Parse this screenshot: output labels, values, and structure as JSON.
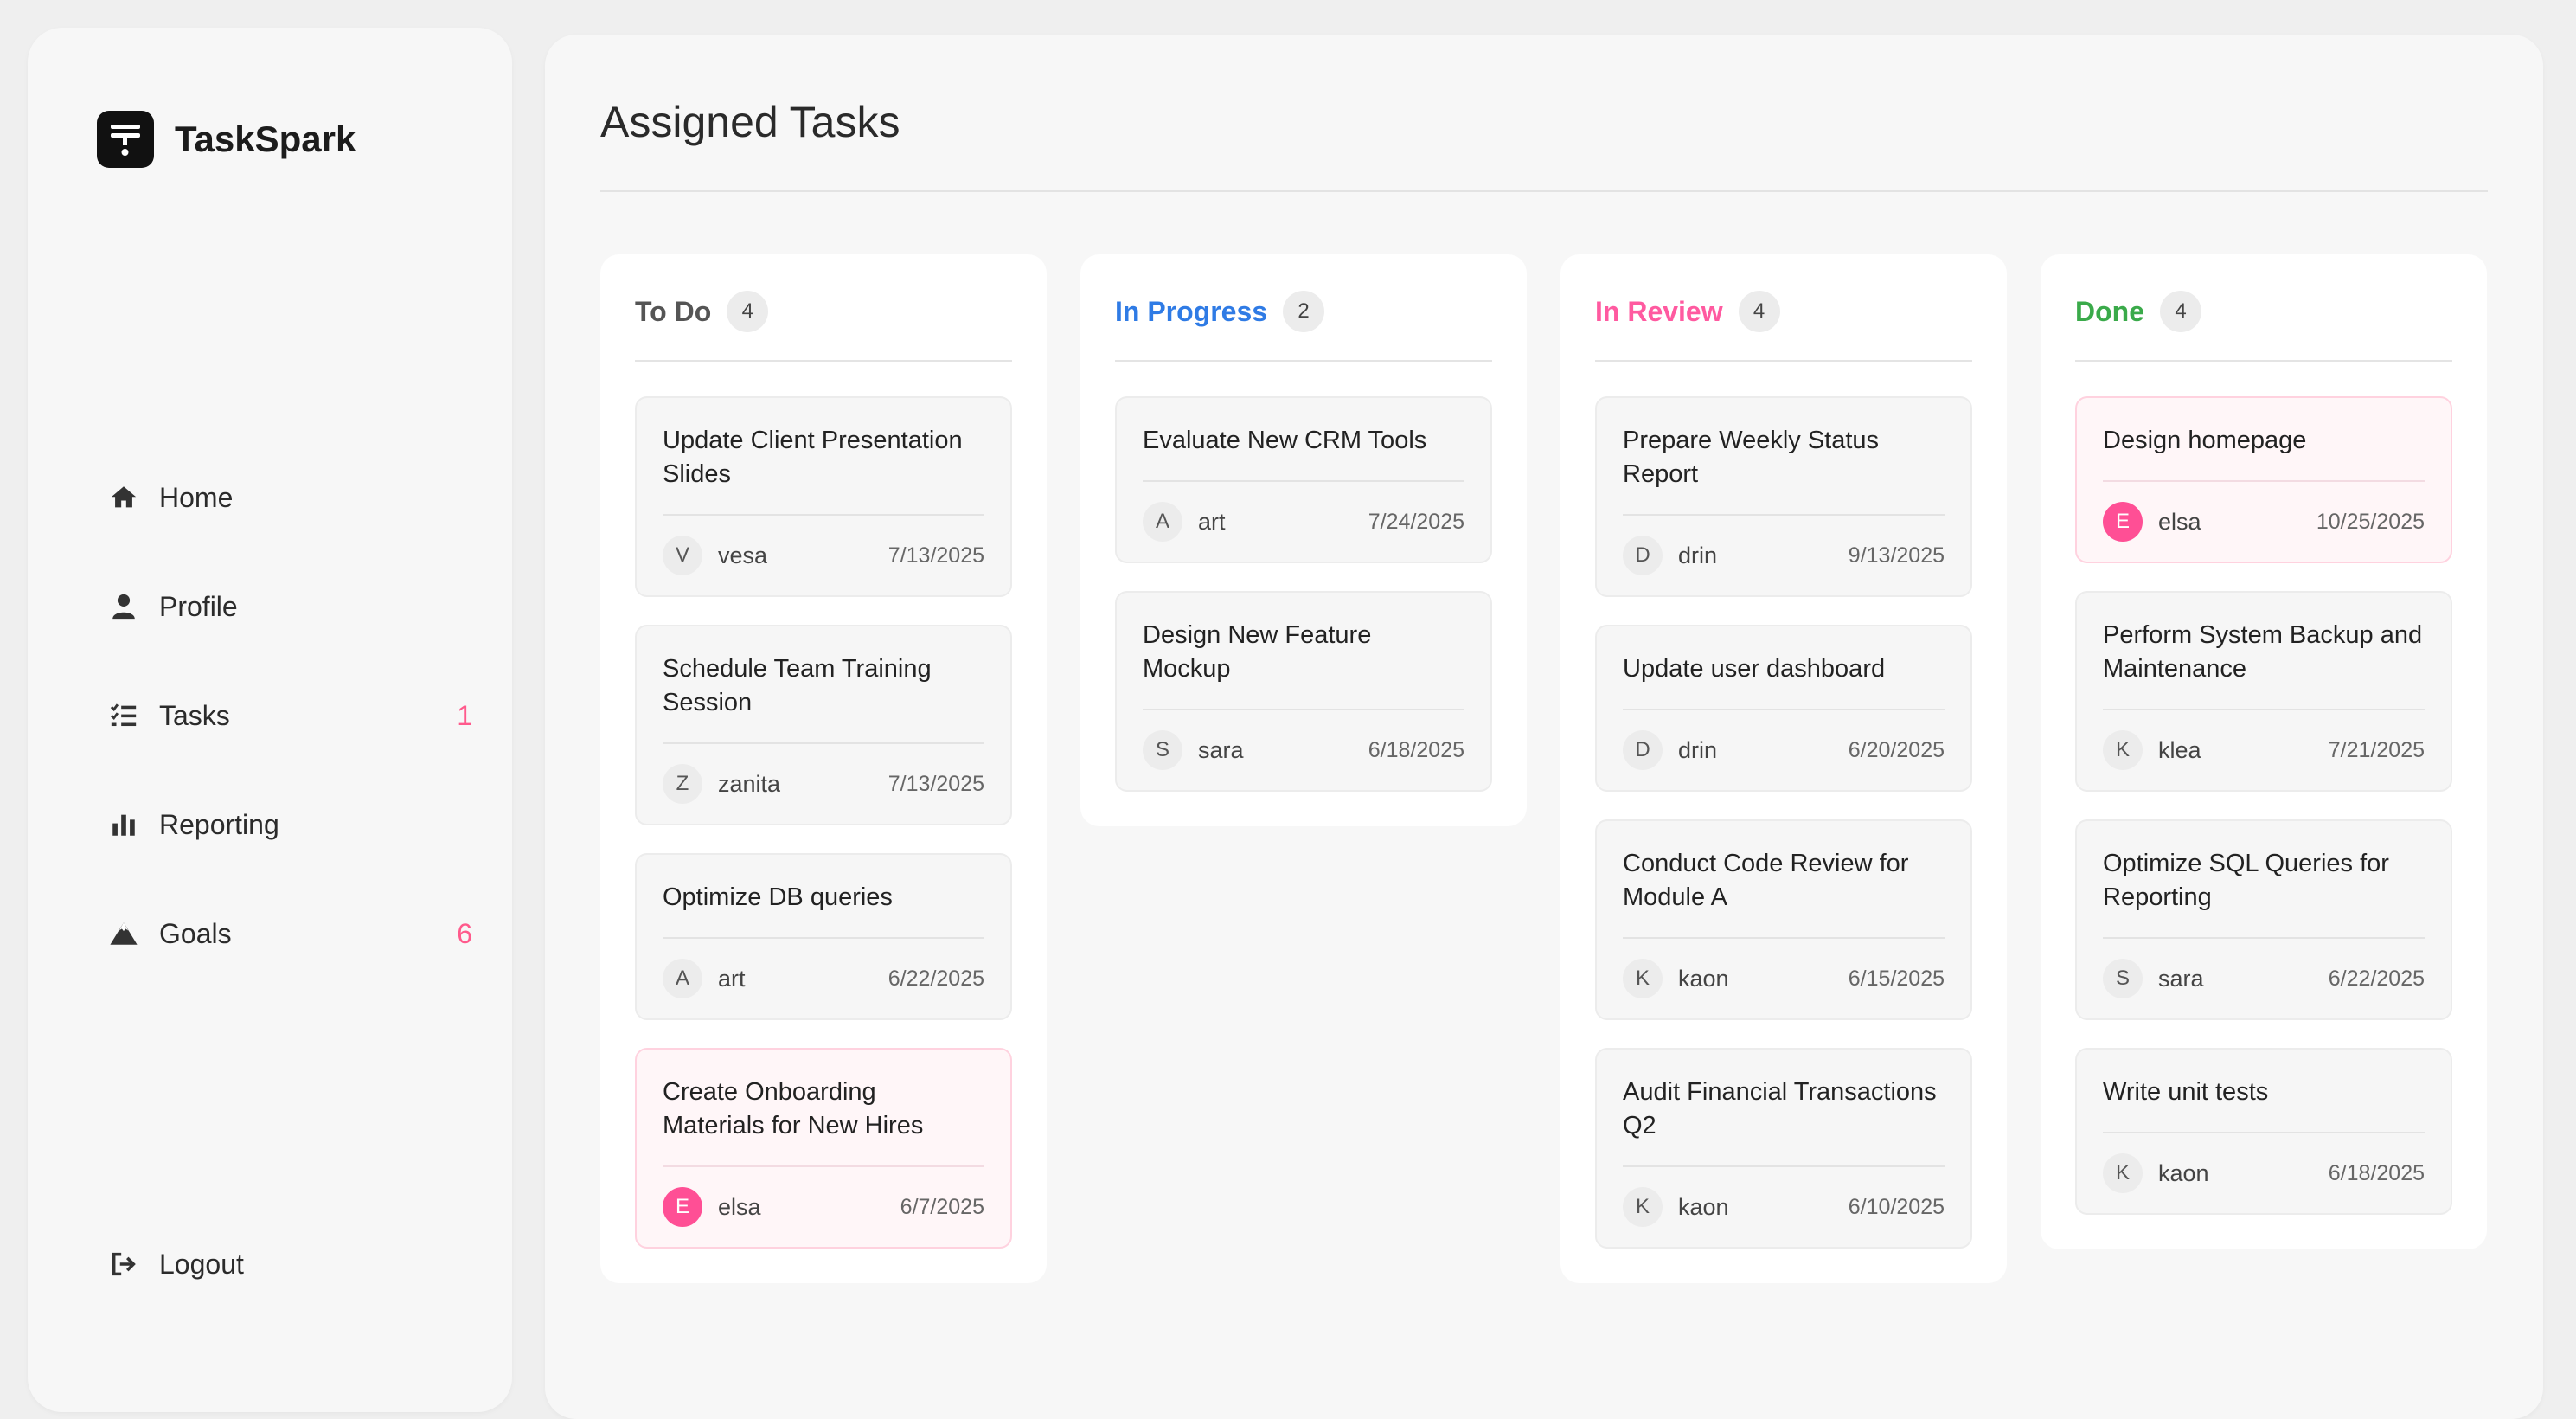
{
  "brand": {
    "name": "TaskSpark"
  },
  "nav": {
    "items": [
      {
        "label": "Home",
        "icon": "home-icon",
        "badge": ""
      },
      {
        "label": "Profile",
        "icon": "user-icon",
        "badge": ""
      },
      {
        "label": "Tasks",
        "icon": "checklist-icon",
        "badge": "1"
      },
      {
        "label": "Reporting",
        "icon": "bar-chart-icon",
        "badge": ""
      },
      {
        "label": "Goals",
        "icon": "mountain-icon",
        "badge": "6"
      }
    ],
    "logout": {
      "label": "Logout",
      "icon": "logout-icon"
    }
  },
  "page": {
    "title": "Assigned Tasks"
  },
  "colors": {
    "todo": "#555555",
    "in_progress": "#2f7be5",
    "in_review": "#ff5aa0",
    "done": "#3aaa4a",
    "badge": "#ff5a8c"
  },
  "columns": [
    {
      "title": "To Do",
      "count": "4",
      "cards": [
        {
          "title": "Update Client Presentation Slides",
          "initial": "V",
          "assignee": "vesa",
          "date": "7/13/2025"
        },
        {
          "title": "Schedule Team Training Session",
          "initial": "Z",
          "assignee": "zanita",
          "date": "7/13/2025"
        },
        {
          "title": "Optimize DB queries",
          "initial": "A",
          "assignee": "art",
          "date": "6/22/2025"
        },
        {
          "title": "Create Onboarding Materials for New Hires",
          "initial": "E",
          "assignee": "elsa",
          "date": "6/7/2025"
        }
      ]
    },
    {
      "title": "In Progress",
      "count": "2",
      "cards": [
        {
          "title": "Evaluate New CRM Tools",
          "initial": "A",
          "assignee": "art",
          "date": "7/24/2025"
        },
        {
          "title": "Design New Feature Mockup",
          "initial": "S",
          "assignee": "sara",
          "date": "6/18/2025"
        }
      ]
    },
    {
      "title": "In Review",
      "count": "4",
      "cards": [
        {
          "title": "Prepare Weekly Status Report",
          "initial": "D",
          "assignee": "drin",
          "date": "9/13/2025"
        },
        {
          "title": "Update user dashboard",
          "initial": "D",
          "assignee": "drin",
          "date": "6/20/2025"
        },
        {
          "title": "Conduct Code Review for Module A",
          "initial": "K",
          "assignee": "kaon",
          "date": "6/15/2025"
        },
        {
          "title": "Audit Financial Transactions Q2",
          "initial": "K",
          "assignee": "kaon",
          "date": "6/10/2025"
        }
      ]
    },
    {
      "title": "Done",
      "count": "4",
      "cards": [
        {
          "title": "Design homepage",
          "initial": "E",
          "assignee": "elsa",
          "date": "10/25/2025"
        },
        {
          "title": "Perform System Backup and Maintenance",
          "initial": "K",
          "assignee": "klea",
          "date": "7/21/2025"
        },
        {
          "title": "Optimize SQL Queries for Reporting",
          "initial": "S",
          "assignee": "sara",
          "date": "6/22/2025"
        },
        {
          "title": "Write unit tests",
          "initial": "K",
          "assignee": "kaon",
          "date": "6/18/2025"
        }
      ]
    }
  ]
}
